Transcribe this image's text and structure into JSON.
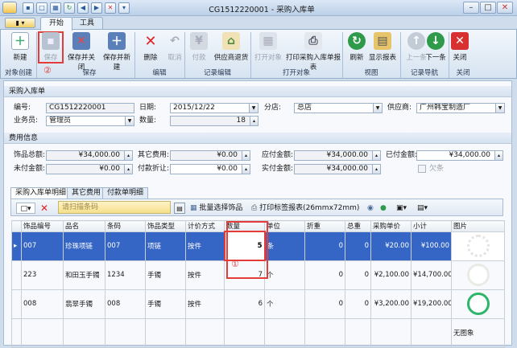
{
  "window": {
    "title": "CG1512220001 - 采购入库单"
  },
  "ribbon_tabs": [
    "开始",
    "工具"
  ],
  "ribbon": {
    "buttons": [
      {
        "label": "新建",
        "icon": "new-doc-icon",
        "enabled": true
      },
      {
        "label": "保存",
        "icon": "save-icon",
        "enabled": false
      },
      {
        "label": "保存并关闭",
        "icon": "save-close-icon",
        "enabled": true
      },
      {
        "label": "保存并新建",
        "icon": "save-new-icon",
        "enabled": true
      },
      {
        "label": "删除",
        "icon": "delete-icon",
        "enabled": true
      },
      {
        "label": "取消",
        "icon": "undo-icon",
        "enabled": false
      },
      {
        "label": "付款",
        "icon": "payment-icon",
        "enabled": false
      },
      {
        "label": "供应商退货",
        "icon": "supplier-return-icon",
        "enabled": true
      },
      {
        "label": "打开对象",
        "icon": "open-object-icon",
        "enabled": false
      },
      {
        "label": "打印采购入库单报表",
        "icon": "printer-icon",
        "enabled": true
      },
      {
        "label": "刷新",
        "icon": "refresh-icon",
        "enabled": true
      },
      {
        "label": "显示报表",
        "icon": "report-icon",
        "enabled": true
      },
      {
        "label": "上一条",
        "icon": "arrow-up-icon",
        "enabled": false
      },
      {
        "label": "下一条",
        "icon": "arrow-down-icon",
        "enabled": true
      },
      {
        "label": "关闭",
        "icon": "close-icon",
        "enabled": true
      }
    ],
    "groups": [
      "对象创建",
      "保存",
      "编辑",
      "记录编辑",
      "打开对象",
      "视图",
      "记录导航",
      "关闭"
    ]
  },
  "annotations": {
    "circle1": "①",
    "circle2": "②"
  },
  "header_section": {
    "title": "采购入库单",
    "labels": {
      "number": "编号:",
      "date": "日期:",
      "branch": "分店:",
      "supplier": "供应商:",
      "clerk": "业务员:",
      "quantity": "数量:"
    },
    "values": {
      "number": "CG1512220001",
      "date": "2015/12/22",
      "branch": "总店",
      "supplier": "广州韩宝制造厂",
      "clerk": "管理员",
      "quantity": "18"
    }
  },
  "cost_section": {
    "title": "费用信息",
    "labels": {
      "goods": "饰品总额:",
      "other": "其它费用:",
      "payable": "应付金额:",
      "paid": "已付金额:",
      "unpaid": "未付金额:",
      "discount": "付款折让:",
      "actual": "实付金额:",
      "owed": "欠条"
    },
    "values": {
      "goods": "¥34,000.00",
      "other": "¥0.00",
      "payable": "¥34,000.00",
      "paid": "¥34,000.00",
      "unpaid": "¥0.00",
      "discount": "¥0.00",
      "actual": "¥34,000.00"
    }
  },
  "detail_tabs": [
    "采购入库单明细",
    "其它费用",
    "付款单明细"
  ],
  "grid_toolbar": {
    "scan_placeholder": "请扫描条码",
    "batch_select": "批量选择饰品",
    "print_labels": "打印标签报表(26mmx72mm)"
  },
  "grid": {
    "columns": [
      "饰品编号",
      "品名",
      "条码",
      "饰品类型",
      "计价方式",
      "数量",
      "单位",
      "折重",
      "总重",
      "采购单价",
      "小计",
      "图片"
    ],
    "rows": [
      {
        "code": "007",
        "name": "珍珠项链",
        "barcode": "007",
        "type": "项链",
        "pricing": "按件",
        "qty": "5",
        "unit": "条",
        "weight": "0",
        "total_weight": "0",
        "price": "¥20.00",
        "subtotal": "¥100.00",
        "image": ""
      },
      {
        "code": "223",
        "name": "和田玉手镯",
        "barcode": "1234",
        "type": "手镯",
        "pricing": "按件",
        "qty": "7",
        "unit": "个",
        "weight": "0",
        "total_weight": "0",
        "price": "¥2,100.00",
        "subtotal": "¥14,700.00",
        "image": ""
      },
      {
        "code": "008",
        "name": "翡翠手镯",
        "barcode": "008",
        "type": "手镯",
        "pricing": "按件",
        "qty": "6",
        "unit": "个",
        "weight": "0",
        "total_weight": "0",
        "price": "¥3,200.00",
        "subtotal": "¥19,200.00",
        "image": ""
      },
      {
        "code": "",
        "name": "",
        "barcode": "",
        "type": "",
        "pricing": "",
        "qty": "",
        "unit": "",
        "weight": "",
        "total_weight": "",
        "price": "",
        "subtotal": "",
        "image": "无图象"
      }
    ]
  },
  "colors": {
    "selection": "#3566c6",
    "annotation": "#e43b3b",
    "ribbon_bg": "#dce8f5"
  }
}
